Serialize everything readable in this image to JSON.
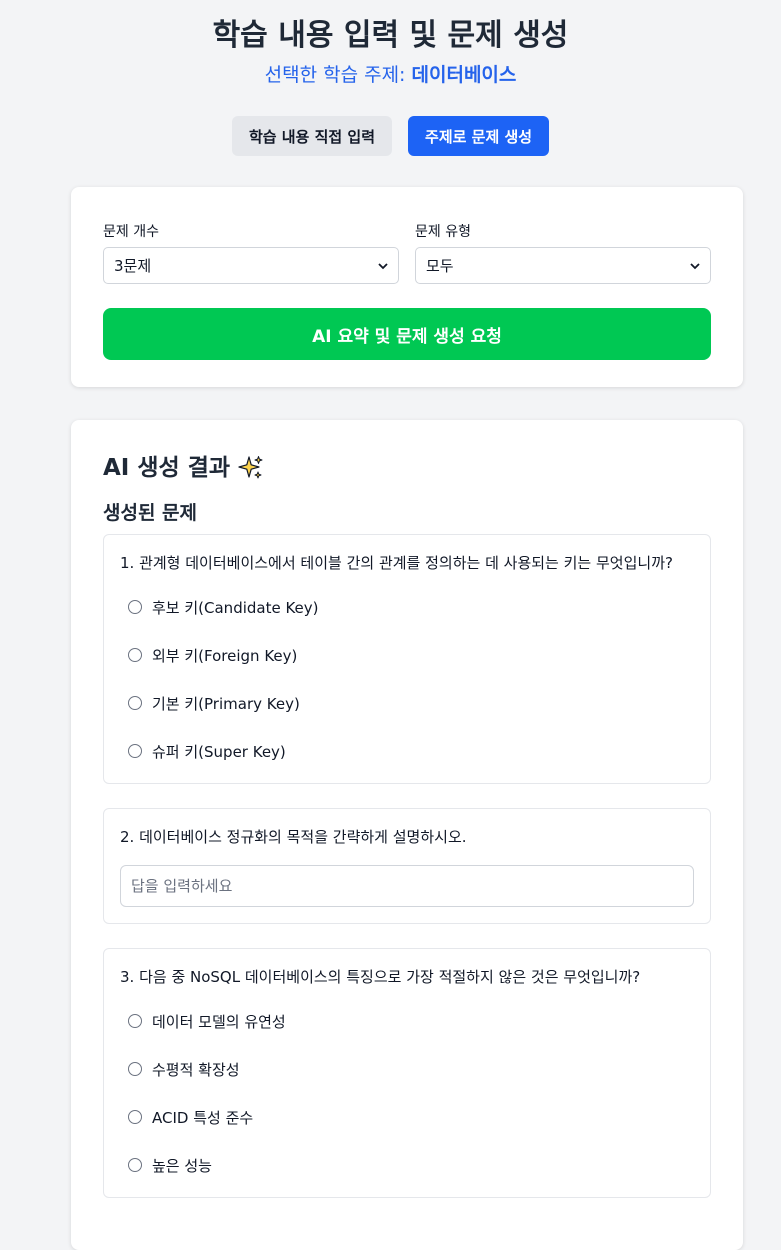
{
  "header": {
    "title": "학습 내용 입력 및 문제 생성",
    "subtitle_prefix": "선택한 학습 주제: ",
    "topic": "데이터베이스"
  },
  "tabs": [
    {
      "label": "학습 내용 직접 입력",
      "active": false
    },
    {
      "label": "주제로 문제 생성",
      "active": true
    }
  ],
  "settings": {
    "count_label": "문제 개수",
    "count_value": "3문제",
    "type_label": "문제 유형",
    "type_value": "모두",
    "generate_label": "AI 요약 및 문제 생성 요청"
  },
  "results": {
    "title": "AI 생성 결과",
    "sparkle_icon": "sparkles-icon",
    "questions_title": "생성된 문제",
    "questions": [
      {
        "text": "1. 관계형 데이터베이스에서 테이블 간의 관계를 정의하는 데 사용되는 키는 무엇입니까?",
        "options": [
          "후보 키(Candidate Key)",
          "외부 키(Foreign Key)",
          "기본 키(Primary Key)",
          "슈퍼 키(Super Key)"
        ]
      },
      {
        "text": "2. 데이터베이스 정규화의 목적을 간략하게 설명하시오.",
        "placeholder": "답을 입력하세요"
      },
      {
        "text": "3. 다음 중 NoSQL 데이터베이스의 특징으로 가장 적절하지 않은 것은 무엇입니까?",
        "options": [
          "데이터 모델의 유연성",
          "수평적 확장성",
          "ACID 특성 준수",
          "높은 성능"
        ]
      }
    ]
  },
  "colors": {
    "primary": "#1d63f5",
    "generate": "#00c853",
    "topic": "#2563eb"
  }
}
